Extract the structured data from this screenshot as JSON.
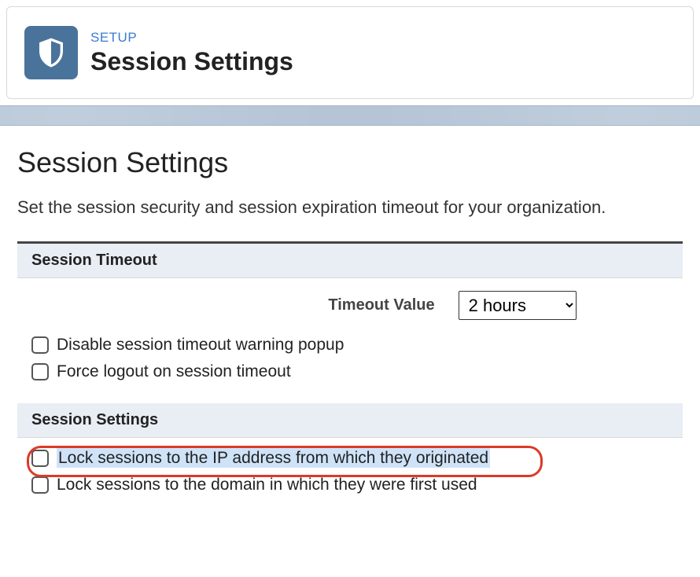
{
  "header": {
    "breadcrumb": "SETUP",
    "title": "Session Settings"
  },
  "main": {
    "heading": "Session Settings",
    "description": "Set the session security and session expiration timeout for your organization."
  },
  "sections": {
    "timeout": {
      "title": "Session Timeout",
      "timeout_label": "Timeout Value",
      "timeout_value": "2 hours",
      "checkboxes": [
        {
          "label": "Disable session timeout warning popup"
        },
        {
          "label": "Force logout on session timeout"
        }
      ]
    },
    "session": {
      "title": "Session Settings",
      "checkboxes": [
        {
          "label": "Lock sessions to the IP address from which they originated"
        },
        {
          "label": "Lock sessions to the domain in which they were first used"
        }
      ]
    }
  }
}
